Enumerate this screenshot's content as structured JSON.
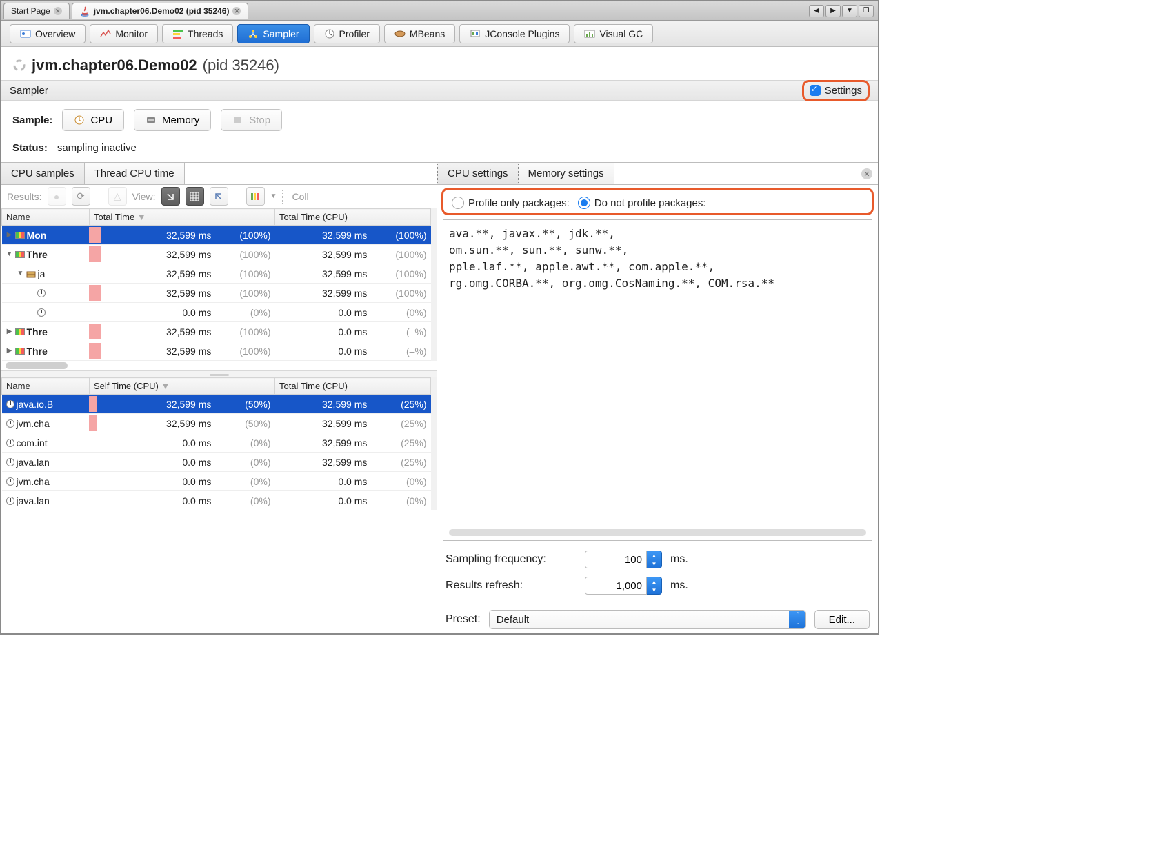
{
  "tabs": {
    "start": "Start Page",
    "process": "jvm.chapter06.Demo02 (pid 35246)"
  },
  "toolbar": [
    "Overview",
    "Monitor",
    "Threads",
    "Sampler",
    "Profiler",
    "MBeans",
    "JConsole Plugins",
    "Visual GC"
  ],
  "header": {
    "proc": "jvm.chapter06.Demo02",
    "pid": "(pid 35246)"
  },
  "section": "Sampler",
  "settings_label": "Settings",
  "sample": {
    "label": "Sample:",
    "cpu": "CPU",
    "memory": "Memory",
    "stop": "Stop"
  },
  "status": {
    "label": "Status:",
    "value": "sampling inactive"
  },
  "left_tabs": [
    "CPU samples",
    "Thread CPU time"
  ],
  "results_label": "Results:",
  "view_label": "View:",
  "coll_label": "Coll",
  "cols_top": {
    "name": "Name",
    "total": "Total Time",
    "total_cpu": "Total Time (CPU)"
  },
  "top_rows": [
    {
      "indent": 0,
      "arrow": "▶",
      "icon": "bar",
      "name": "Mon",
      "sel": true,
      "bar": 18,
      "t": "32,599 ms",
      "tp": "(100%)",
      "c": "32,599 ms",
      "cp": "(100%)"
    },
    {
      "indent": 0,
      "arrow": "▼",
      "icon": "bar",
      "name": "Thre",
      "sel": false,
      "bar": 18,
      "t": "32,599 ms",
      "tp": "(100%)",
      "c": "32,599 ms",
      "cp": "(100%)"
    },
    {
      "indent": 1,
      "arrow": "▼",
      "icon": "pkg",
      "name": "ja",
      "sel": false,
      "bar": 0,
      "t": "32,599 ms",
      "tp": "(100%)",
      "c": "32,599 ms",
      "cp": "(100%)"
    },
    {
      "indent": 2,
      "arrow": "",
      "icon": "clk",
      "name": "",
      "sel": false,
      "bar": 18,
      "t": "32,599 ms",
      "tp": "(100%)",
      "c": "32,599 ms",
      "cp": "(100%)"
    },
    {
      "indent": 2,
      "arrow": "",
      "icon": "clk",
      "name": "",
      "sel": false,
      "bar": 0,
      "t": "0.0 ms",
      "tp": "(0%)",
      "c": "0.0 ms",
      "cp": "(0%)"
    },
    {
      "indent": 0,
      "arrow": "▶",
      "icon": "bar",
      "name": "Thre",
      "sel": false,
      "bar": 18,
      "t": "32,599 ms",
      "tp": "(100%)",
      "c": "0.0 ms",
      "cp": "(–%)"
    },
    {
      "indent": 0,
      "arrow": "▶",
      "icon": "bar",
      "name": "Thre",
      "sel": false,
      "bar": 18,
      "t": "32,599 ms",
      "tp": "(100%)",
      "c": "0.0 ms",
      "cp": "(–%)"
    }
  ],
  "cols_bot": {
    "name": "Name",
    "self": "Self Time (CPU)",
    "total": "Total Time (CPU)"
  },
  "bot_rows": [
    {
      "name": "java.io.B",
      "sel": true,
      "bar": 12,
      "s": "32,599 ms",
      "sp": "(50%)",
      "t": "32,599 ms",
      "tp": "(25%)"
    },
    {
      "name": "jvm.cha",
      "sel": false,
      "bar": 12,
      "s": "32,599 ms",
      "sp": "(50%)",
      "t": "32,599 ms",
      "tp": "(25%)"
    },
    {
      "name": "com.int",
      "sel": false,
      "bar": 0,
      "s": "0.0 ms",
      "sp": "(0%)",
      "t": "32,599 ms",
      "tp": "(25%)"
    },
    {
      "name": "java.lan",
      "sel": false,
      "bar": 0,
      "s": "0.0 ms",
      "sp": "(0%)",
      "t": "32,599 ms",
      "tp": "(25%)"
    },
    {
      "name": "jvm.cha",
      "sel": false,
      "bar": 0,
      "s": "0.0 ms",
      "sp": "(0%)",
      "t": "0.0 ms",
      "tp": "(0%)"
    },
    {
      "name": "java.lan",
      "sel": false,
      "bar": 0,
      "s": "0.0 ms",
      "sp": "(0%)",
      "t": "0.0 ms",
      "tp": "(0%)"
    }
  ],
  "right_tabs": [
    "CPU settings",
    "Memory settings"
  ],
  "radios": {
    "only": "Profile only packages:",
    "not": "Do not profile packages:"
  },
  "filter_text": "ava.**, javax.**, jdk.**,\nom.sun.**, sun.**, sunw.**,\npple.laf.**, apple.awt.**, com.apple.**,\nrg.omg.CORBA.**, org.omg.CosNaming.**, COM.rsa.**",
  "freq": {
    "label": "Sampling frequency:",
    "value": "100",
    "unit": "ms."
  },
  "refresh": {
    "label": "Results refresh:",
    "value": "1,000",
    "unit": "ms."
  },
  "preset": {
    "label": "Preset:",
    "value": "Default",
    "edit": "Edit..."
  }
}
